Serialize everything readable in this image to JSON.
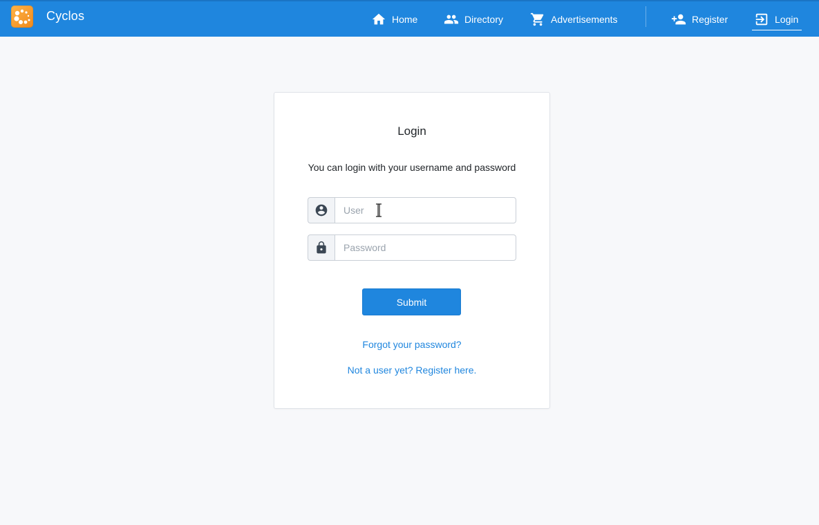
{
  "header": {
    "app_name": "Cyclos",
    "nav": [
      {
        "label": "Home",
        "icon": "home-icon"
      },
      {
        "label": "Directory",
        "icon": "people-icon"
      },
      {
        "label": "Advertisements",
        "icon": "cart-icon"
      },
      {
        "label": "Register",
        "icon": "person-add-icon"
      },
      {
        "label": "Login",
        "icon": "login-icon",
        "active": true
      }
    ]
  },
  "login": {
    "title": "Login",
    "subtitle": "You can login with your username and password",
    "user_placeholder": "User",
    "user_value": "",
    "password_placeholder": "Password",
    "password_value": "",
    "submit_label": "Submit",
    "forgot_link": "Forgot your password?",
    "register_link": "Not a user yet? Register here."
  },
  "colors": {
    "primary": "#1f86de",
    "background": "#f7f8fa",
    "card": "#ffffff"
  }
}
